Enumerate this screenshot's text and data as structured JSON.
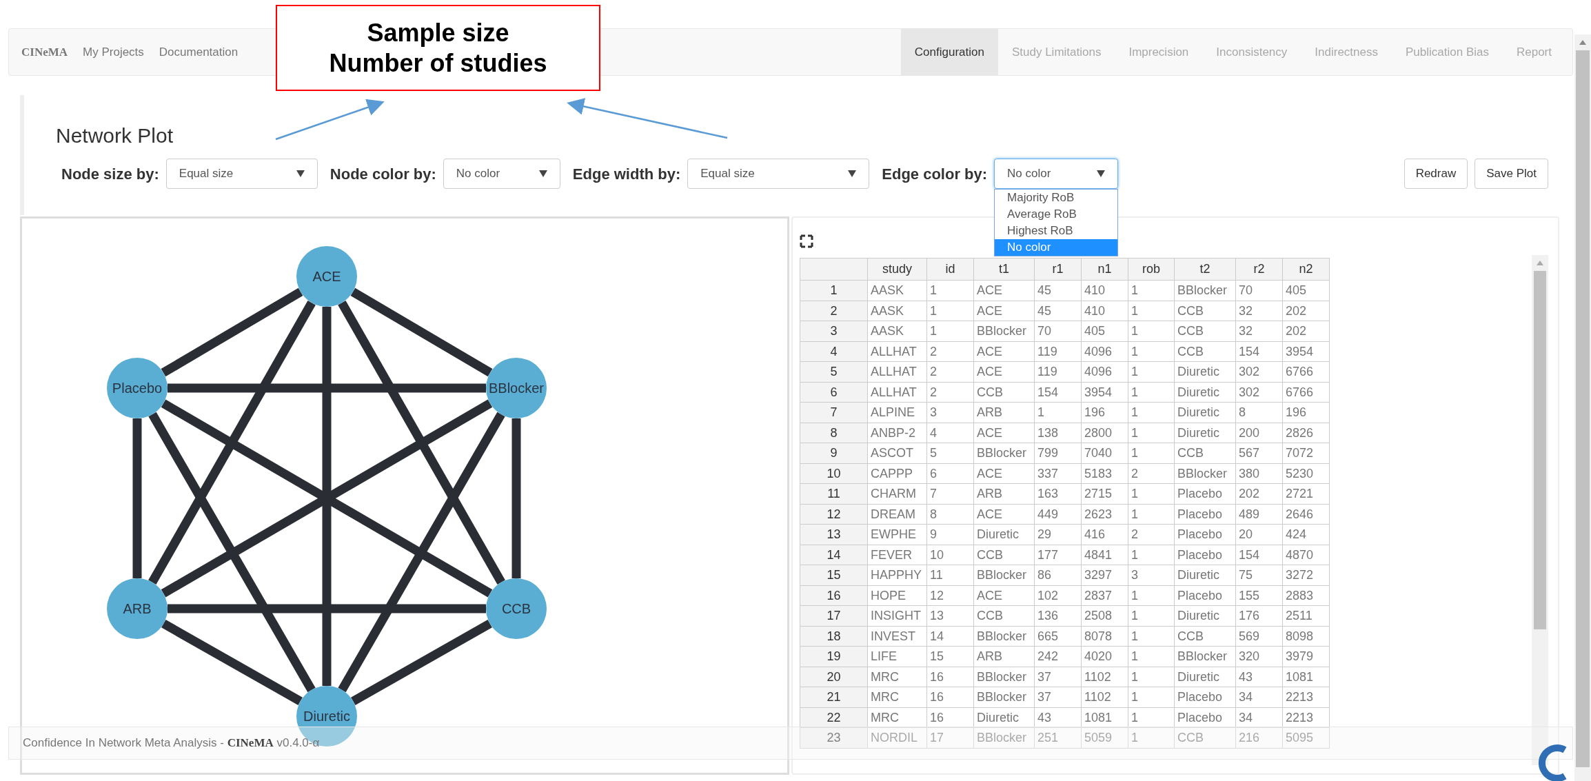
{
  "annotation": {
    "lines": [
      "Sample size",
      "Number of studies"
    ]
  },
  "navbar": {
    "brand": "CINeMA",
    "links": [
      "My Projects",
      "Documentation"
    ],
    "tabs": [
      {
        "label": "Configuration",
        "selected": true,
        "disabled": false
      },
      {
        "label": "Study Limitations",
        "selected": false,
        "disabled": true
      },
      {
        "label": "Imprecision",
        "selected": false,
        "disabled": true
      },
      {
        "label": "Inconsistency",
        "selected": false,
        "disabled": true
      },
      {
        "label": "Indirectness",
        "selected": false,
        "disabled": true
      },
      {
        "label": "Publication Bias",
        "selected": false,
        "disabled": true
      },
      {
        "label": "Report",
        "selected": false,
        "disabled": true
      }
    ]
  },
  "page": {
    "title": "Network Plot",
    "controls": [
      {
        "label": "Node size by:",
        "value": "Equal size",
        "open": false
      },
      {
        "label": "Node color by:",
        "value": "No color",
        "open": false
      },
      {
        "label": "Edge width by:",
        "value": "Equal size",
        "open": false
      },
      {
        "label": "Edge color by:",
        "value": "No color",
        "open": true,
        "options": [
          {
            "label": "Majority RoB",
            "selected": false
          },
          {
            "label": "Average RoB",
            "selected": false
          },
          {
            "label": "Highest RoB",
            "selected": false
          },
          {
            "label": "No color",
            "selected": true
          }
        ]
      }
    ],
    "buttons": [
      "Redraw",
      "Save Plot"
    ]
  },
  "network_plot": {
    "nodes": [
      "ACE",
      "Placebo",
      "BBlocker",
      "ARB",
      "CCB",
      "Diuretic"
    ]
  },
  "table": {
    "columns": [
      "study",
      "id",
      "t1",
      "r1",
      "n1",
      "rob",
      "t2",
      "r2",
      "n2"
    ],
    "rows": [
      {
        "number": "1",
        "cells": [
          "AASK",
          "1",
          "ACE",
          "45",
          "410",
          "1",
          "BBlocker",
          "70",
          "405"
        ]
      },
      {
        "number": "2",
        "cells": [
          "AASK",
          "1",
          "ACE",
          "45",
          "410",
          "1",
          "CCB",
          "32",
          "202"
        ]
      },
      {
        "number": "3",
        "cells": [
          "AASK",
          "1",
          "BBlocker",
          "70",
          "405",
          "1",
          "CCB",
          "32",
          "202"
        ]
      },
      {
        "number": "4",
        "cells": [
          "ALLHAT",
          "2",
          "ACE",
          "119",
          "4096",
          "1",
          "CCB",
          "154",
          "3954"
        ]
      },
      {
        "number": "5",
        "cells": [
          "ALLHAT",
          "2",
          "ACE",
          "119",
          "4096",
          "1",
          "Diuretic",
          "302",
          "6766"
        ]
      },
      {
        "number": "6",
        "cells": [
          "ALLHAT",
          "2",
          "CCB",
          "154",
          "3954",
          "1",
          "Diuretic",
          "302",
          "6766"
        ]
      },
      {
        "number": "7",
        "cells": [
          "ALPINE",
          "3",
          "ARB",
          "1",
          "196",
          "1",
          "Diuretic",
          "8",
          "196"
        ]
      },
      {
        "number": "8",
        "cells": [
          "ANBP-2",
          "4",
          "ACE",
          "138",
          "2800",
          "1",
          "Diuretic",
          "200",
          "2826"
        ]
      },
      {
        "number": "9",
        "cells": [
          "ASCOT",
          "5",
          "BBlocker",
          "799",
          "7040",
          "1",
          "CCB",
          "567",
          "7072"
        ]
      },
      {
        "number": "10",
        "cells": [
          "CAPPP",
          "6",
          "ACE",
          "337",
          "5183",
          "2",
          "BBlocker",
          "380",
          "5230"
        ]
      },
      {
        "number": "11",
        "cells": [
          "CHARM",
          "7",
          "ARB",
          "163",
          "2715",
          "1",
          "Placebo",
          "202",
          "2721"
        ]
      },
      {
        "number": "12",
        "cells": [
          "DREAM",
          "8",
          "ACE",
          "449",
          "2623",
          "1",
          "Placebo",
          "489",
          "2646"
        ]
      },
      {
        "number": "13",
        "cells": [
          "EWPHE",
          "9",
          "Diuretic",
          "29",
          "416",
          "2",
          "Placebo",
          "20",
          "424"
        ]
      },
      {
        "number": "14",
        "cells": [
          "FEVER",
          "10",
          "CCB",
          "177",
          "4841",
          "1",
          "Placebo",
          "154",
          "4870"
        ]
      },
      {
        "number": "15",
        "cells": [
          "HAPPHY",
          "11",
          "BBlocker",
          "86",
          "3297",
          "3",
          "Diuretic",
          "75",
          "3272"
        ]
      },
      {
        "number": "16",
        "cells": [
          "HOPE",
          "12",
          "ACE",
          "102",
          "2837",
          "1",
          "Placebo",
          "155",
          "2883"
        ]
      },
      {
        "number": "17",
        "cells": [
          "INSIGHT",
          "13",
          "CCB",
          "136",
          "2508",
          "1",
          "Diuretic",
          "176",
          "2511"
        ]
      },
      {
        "number": "18",
        "cells": [
          "INVEST",
          "14",
          "BBlocker",
          "665",
          "8078",
          "1",
          "CCB",
          "569",
          "8098"
        ]
      },
      {
        "number": "19",
        "cells": [
          "LIFE",
          "15",
          "ARB",
          "242",
          "4020",
          "1",
          "BBlocker",
          "320",
          "3979"
        ]
      },
      {
        "number": "20",
        "cells": [
          "MRC",
          "16",
          "BBlocker",
          "37",
          "1102",
          "1",
          "Diuretic",
          "43",
          "1081"
        ]
      },
      {
        "number": "21",
        "cells": [
          "MRC",
          "16",
          "BBlocker",
          "37",
          "1102",
          "1",
          "Placebo",
          "34",
          "2213"
        ]
      },
      {
        "number": "22",
        "cells": [
          "MRC",
          "16",
          "Diuretic",
          "43",
          "1081",
          "1",
          "Placebo",
          "34",
          "2213"
        ]
      },
      {
        "number": "23",
        "cells": [
          "NORDIL",
          "17",
          "BBlocker",
          "251",
          "5059",
          "1",
          "CCB",
          "216",
          "5095"
        ]
      }
    ]
  },
  "footer": {
    "text": "Confidence In Network Meta Analysis - **CINeMA** v0.4.0-α"
  }
}
